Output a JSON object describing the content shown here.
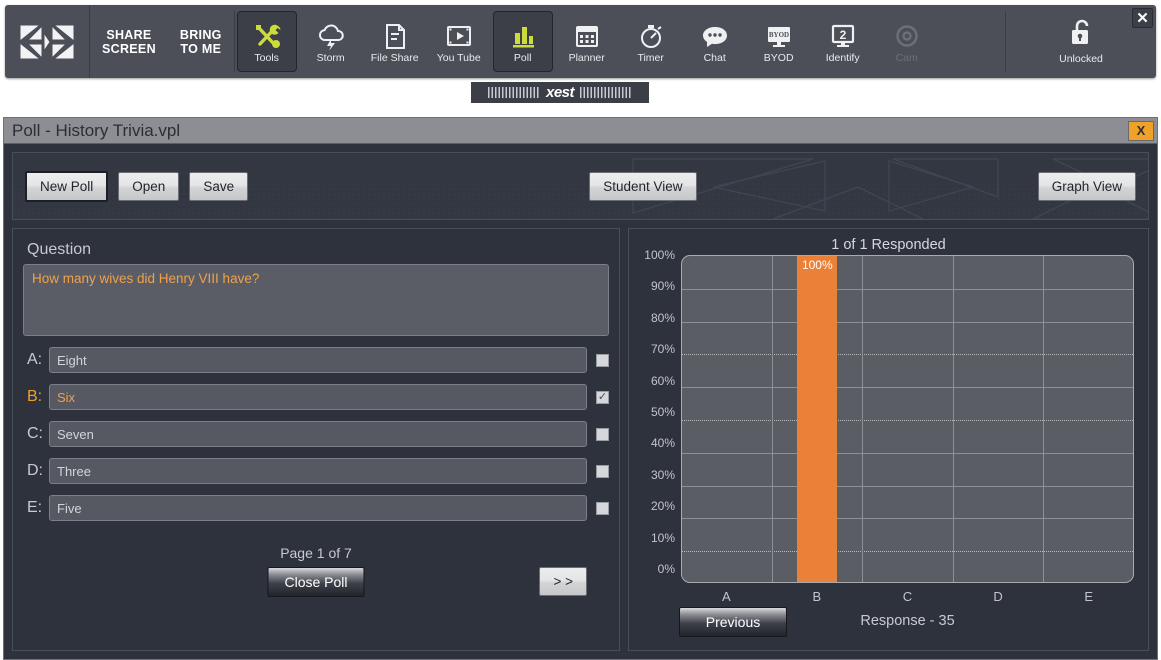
{
  "toolbar": {
    "logo_icon": "xest-x-logo-icon",
    "text_buttons": [
      {
        "name": "share-screen",
        "line1": "SHARE",
        "line2": "SCREEN"
      },
      {
        "name": "bring-to-me",
        "line1": "BRING",
        "line2": "TO ME"
      }
    ],
    "items": [
      {
        "name": "tools",
        "label": "Tools",
        "icon": "wrench-screwdriver-icon",
        "active": true,
        "dim": false
      },
      {
        "name": "storm",
        "label": "Storm",
        "icon": "cloud-lightning-icon",
        "active": false,
        "dim": false
      },
      {
        "name": "fileshare",
        "label": "File Share",
        "icon": "document-icon",
        "active": false,
        "dim": false
      },
      {
        "name": "youtube",
        "label": "You Tube",
        "icon": "video-play-icon",
        "active": false,
        "dim": false
      },
      {
        "name": "poll",
        "label": "Poll",
        "icon": "bar-chart-icon",
        "active": true,
        "dim": false
      },
      {
        "name": "planner",
        "label": "Planner",
        "icon": "calendar-icon",
        "active": false,
        "dim": false
      },
      {
        "name": "timer",
        "label": "Timer",
        "icon": "stopwatch-icon",
        "active": false,
        "dim": false
      },
      {
        "name": "chat",
        "label": "Chat",
        "icon": "speech-bubble-icon",
        "active": false,
        "dim": false
      },
      {
        "name": "byod",
        "label": "BYOD",
        "icon": "byod-monitor-icon",
        "active": false,
        "dim": false
      },
      {
        "name": "identify",
        "label": "Identify",
        "icon": "monitor-number-2-icon",
        "active": false,
        "dim": false
      },
      {
        "name": "cam",
        "label": "Cam",
        "icon": "camera-lens-icon",
        "active": false,
        "dim": true
      }
    ],
    "lock": {
      "label": "Unlocked",
      "icon": "open-padlock-icon"
    },
    "close_label": "✕",
    "brand_tab": "xest"
  },
  "window": {
    "title": "Poll - History Trivia.vpl",
    "close_label": "X"
  },
  "commandbar": {
    "new_poll": "New Poll",
    "open": "Open",
    "save": "Save",
    "student_view": "Student View",
    "graph_view": "Graph View"
  },
  "question_panel": {
    "heading": "Question",
    "question_text": "How many wives did Henry VIII have?",
    "answers": [
      {
        "letter": "A:",
        "text": "Eight",
        "checked": false,
        "correct": false
      },
      {
        "letter": "B:",
        "text": "Six",
        "checked": true,
        "correct": true
      },
      {
        "letter": "C:",
        "text": "Seven",
        "checked": false,
        "correct": false
      },
      {
        "letter": "D:",
        "text": "Three",
        "checked": false,
        "correct": false
      },
      {
        "letter": "E:",
        "text": "Five",
        "checked": false,
        "correct": false
      }
    ],
    "page_info": "Page 1 of 7",
    "close_poll": "Close Poll",
    "next": "> >",
    "checkmark": "✓"
  },
  "graph_panel": {
    "previous": "Previous"
  },
  "colors": {
    "accent_orange": "#ea8138",
    "toolbar_yellow": "#cddc39",
    "window_bg": "#2e323c",
    "plot_bg": "#5a5d63",
    "title_bar": "#8c8e93"
  },
  "chart_data": {
    "type": "bar",
    "title": "1 of 1 Responded",
    "categories": [
      "A",
      "B",
      "C",
      "D",
      "E"
    ],
    "values": [
      0,
      100,
      0,
      0,
      0
    ],
    "bar_labels": [
      "",
      "100%",
      "",
      "",
      ""
    ],
    "xlabel": "Response - 35",
    "ylabel": "",
    "ylim": [
      0,
      100
    ],
    "ytick_labels": [
      "100%",
      "90%",
      "80%",
      "70%",
      "60%",
      "50%",
      "40%",
      "30%",
      "20%",
      "10%",
      "0%"
    ],
    "ytick_values": [
      100,
      90,
      80,
      70,
      60,
      50,
      40,
      30,
      20,
      10,
      0
    ],
    "grid": true,
    "legend": "none",
    "bar_color": "#ea8138"
  }
}
